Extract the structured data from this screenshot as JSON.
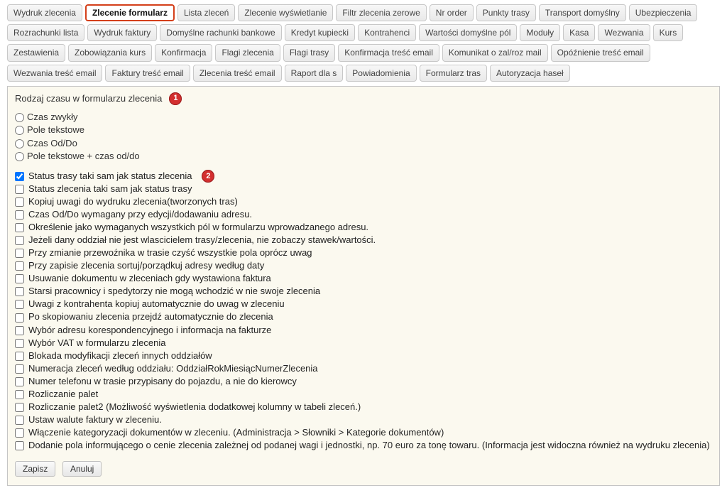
{
  "tabs": [
    {
      "id": "wydruk-zlecenia",
      "label": "Wydruk zlecenia",
      "active": false
    },
    {
      "id": "zlecenie-formularz",
      "label": "Zlecenie formularz",
      "active": true
    },
    {
      "id": "lista-zlecen",
      "label": "Lista zleceń",
      "active": false
    },
    {
      "id": "zlecenie-wyswietlanie",
      "label": "Zlecenie wyświetlanie",
      "active": false
    },
    {
      "id": "filtr-zlecenia-zerowe",
      "label": "Filtr zlecenia zerowe",
      "active": false
    },
    {
      "id": "nr-order",
      "label": "Nr order",
      "active": false
    },
    {
      "id": "punkty-trasy",
      "label": "Punkty trasy",
      "active": false
    },
    {
      "id": "transport-domyslny",
      "label": "Transport domyślny",
      "active": false
    },
    {
      "id": "ubezpieczenia",
      "label": "Ubezpieczenia",
      "active": false
    },
    {
      "id": "rozrachunki-lista",
      "label": "Rozrachunki lista",
      "active": false
    },
    {
      "id": "wydruk-faktury",
      "label": "Wydruk faktury",
      "active": false
    },
    {
      "id": "domyslne-rachunki-bankowe",
      "label": "Domyślne rachunki bankowe",
      "active": false
    },
    {
      "id": "kredyt-kupiecki",
      "label": "Kredyt kupiecki",
      "active": false
    },
    {
      "id": "kontrahenci",
      "label": "Kontrahenci",
      "active": false
    },
    {
      "id": "wartosci-domyslne-pol",
      "label": "Wartości domyślne pól",
      "active": false
    },
    {
      "id": "moduly",
      "label": "Moduły",
      "active": false
    },
    {
      "id": "kasa",
      "label": "Kasa",
      "active": false
    },
    {
      "id": "wezwania",
      "label": "Wezwania",
      "active": false
    },
    {
      "id": "kurs",
      "label": "Kurs",
      "active": false
    },
    {
      "id": "zestawienia",
      "label": "Zestawienia",
      "active": false
    },
    {
      "id": "zobowiazania-kurs",
      "label": "Zobowiązania kurs",
      "active": false
    },
    {
      "id": "konfirmacja",
      "label": "Konfirmacja",
      "active": false
    },
    {
      "id": "flagi-zlecenia",
      "label": "Flagi zlecenia",
      "active": false
    },
    {
      "id": "flagi-trasy",
      "label": "Flagi trasy",
      "active": false
    },
    {
      "id": "konfirmacja-tresc-email",
      "label": "Konfirmacja treść email",
      "active": false
    },
    {
      "id": "komunikat-o-zal-roz-mail",
      "label": "Komunikat o zal/roz mail",
      "active": false
    },
    {
      "id": "opoznienie-tresc-email",
      "label": "Opóźnienie treść email",
      "active": false
    },
    {
      "id": "wezwania-tresc-email",
      "label": "Wezwania treść email",
      "active": false
    },
    {
      "id": "faktury-tresc-email",
      "label": "Faktury treść email",
      "active": false
    },
    {
      "id": "zlecenia-tresc-email",
      "label": "Zlecenia treść email",
      "active": false
    },
    {
      "id": "raport-dla-s",
      "label": "Raport dla s",
      "active": false
    },
    {
      "id": "powiadomienia",
      "label": "Powiadomienia",
      "active": false
    },
    {
      "id": "formularz-tras",
      "label": "Formularz tras",
      "active": false
    },
    {
      "id": "autoryzacja-hasel",
      "label": "Autoryzacja haseł",
      "active": false
    }
  ],
  "panel": {
    "title": "Rodzaj czasu w formularzu zlecenia",
    "badge1": "1",
    "badge2": "2",
    "radios": [
      {
        "id": "czas-zwykly",
        "label": "Czas zwykły",
        "checked": false
      },
      {
        "id": "pole-tekstowe",
        "label": "Pole tekstowe",
        "checked": false
      },
      {
        "id": "czas-od-do",
        "label": "Czas Od/Do",
        "checked": false
      },
      {
        "id": "pole-tekstowe-czas-od-do",
        "label": "Pole tekstowe + czas od/do",
        "checked": false
      }
    ],
    "checks": [
      {
        "id": "status-trasy-jak-zlecenia",
        "label": "Status trasy taki sam jak status zlecenia",
        "checked": true
      },
      {
        "id": "status-zlecenia-jak-trasy",
        "label": "Status zlecenia taki sam jak status trasy",
        "checked": false
      },
      {
        "id": "kopiuj-uwagi",
        "label": "Kopiuj uwagi do wydruku zlecenia(tworzonych tras)",
        "checked": false
      },
      {
        "id": "czas-od-do-wymagany",
        "label": "Czas Od/Do wymagany przy edycji/dodawaniu adresu.",
        "checked": false
      },
      {
        "id": "okreslenie-jako-wymaganych",
        "label": "Określenie jako wymaganych wszystkich pól w formularzu wprowadzanego adresu.",
        "checked": false
      },
      {
        "id": "oddzial-nie-wlasciciel",
        "label": "Jeżeli dany oddział nie jest wlascicielem trasy/zlecenia, nie zobaczy stawek/wartości.",
        "checked": false
      },
      {
        "id": "czysc-pola-przewoznik",
        "label": "Przy zmianie przewoźnika w trasie czyść wszystkie pola oprócz uwag",
        "checked": false
      },
      {
        "id": "sortuj-adresy-wedlug-daty",
        "label": "Przy zapisie zlecenia sortuj/porządkuj adresy według daty",
        "checked": false
      },
      {
        "id": "usuwanie-dokumentu",
        "label": "Usuwanie dokumentu w zleceniach gdy wystawiona faktura",
        "checked": false
      },
      {
        "id": "starsi-pracownicy",
        "label": "Starsi pracownicy i spedytorzy nie mogą wchodzić w nie swoje zlecenia",
        "checked": false
      },
      {
        "id": "uwagi-z-kontrahenta",
        "label": "Uwagi z kontrahenta kopiuj automatycznie do uwag w zleceniu",
        "checked": false
      },
      {
        "id": "po-skopiowaniu-przejdz",
        "label": "Po skopiowaniu zlecenia przejdź automatycznie do zlecenia",
        "checked": false
      },
      {
        "id": "wybor-adresu-korespond",
        "label": "Wybór adresu korespondencyjnego i informacja na fakturze",
        "checked": false
      },
      {
        "id": "wybor-vat",
        "label": "Wybór VAT w formularzu zlecenia",
        "checked": false
      },
      {
        "id": "blokada-modyfikacji",
        "label": "Blokada modyfikacji zleceń innych oddziałów",
        "checked": false
      },
      {
        "id": "numeracja-zlecen",
        "label": "Numeracja zleceń według oddziału: OddziałRokMiesiącNumerZlecenia",
        "checked": false
      },
      {
        "id": "numer-telefonu-w-trasie",
        "label": "Numer telefonu w trasie przypisany do pojazdu, a nie do kierowcy",
        "checked": false
      },
      {
        "id": "rozliczanie-palet",
        "label": "Rozliczanie palet",
        "checked": false
      },
      {
        "id": "rozliczanie-palet2",
        "label": "Rozliczanie palet2 (Możliwość wyświetlenia dodatkowej kolumny w tabeli zleceń.)",
        "checked": false
      },
      {
        "id": "ustaw-walute-faktury",
        "label": "Ustaw walute faktury w zleceniu.",
        "checked": false
      },
      {
        "id": "wlaczenie-kategoryzacji",
        "label": "Włączenie kategoryzacji dokumentów w zleceniu. (Administracja > Słowniki > Kategorie dokumentów)",
        "checked": false
      },
      {
        "id": "dodanie-pola-cena",
        "label": "Dodanie pola informującego o cenie zlecenia zależnej od podanej wagi i jednostki, np. 70 euro za tonę towaru. (Informacja jest widoczna również na wydruku zlecenia)",
        "checked": false
      }
    ],
    "buttons": {
      "save": "Zapisz",
      "cancel": "Anuluj"
    }
  }
}
